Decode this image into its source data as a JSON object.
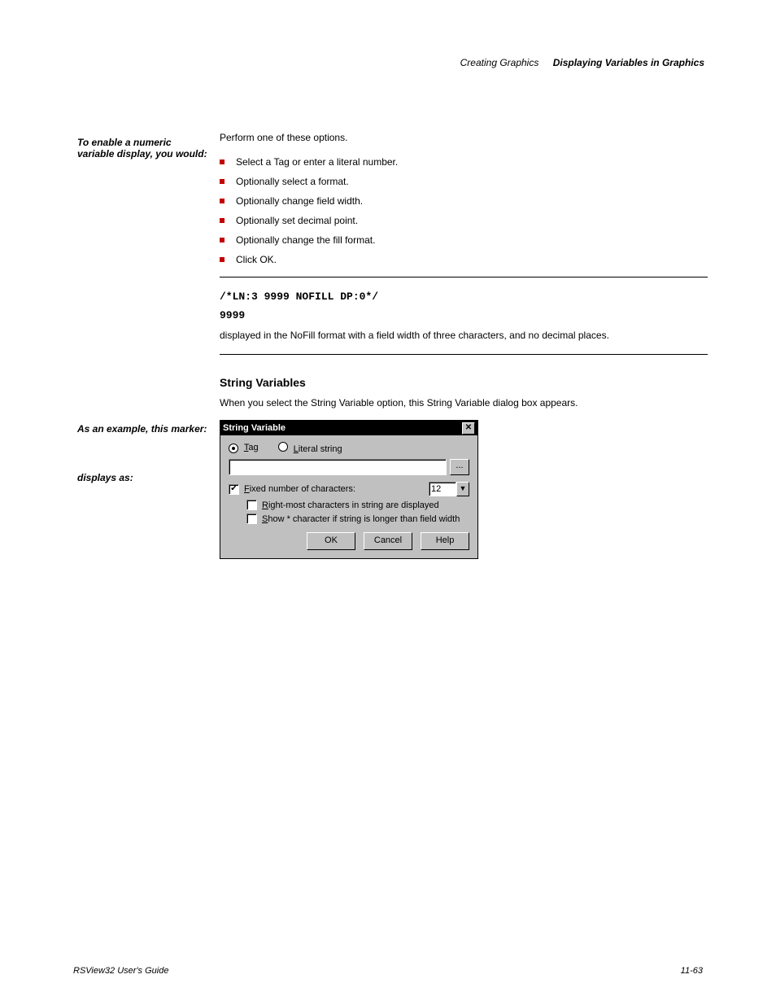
{
  "header": {
    "chapter": "Creating Graphics",
    "section": "Displaying Variables in Graphics"
  },
  "sideLabels": {
    "enable": "To enable a numeric variable display, you would:",
    "example": "As an example, this marker:",
    "result": "displays as:"
  },
  "enableSteps": {
    "intro": "Perform one of these options.",
    "items": [
      "Select a Tag or enter a literal number.",
      "Optionally select a format.",
      "Optionally change field width.",
      "Optionally set decimal point.",
      "Optionally change the fill format.",
      "Click OK."
    ]
  },
  "exampleCode": "/*LN:3 9999 NOFILL DP:0*/",
  "resultValue": "9999",
  "resultNote": "displayed in the NoFill format with a field width of three characters, and no decimal places.",
  "stringSection": {
    "heading": "String Variables",
    "sub": "When you select the String Variable option, this String Variable dialog box appears."
  },
  "dialog": {
    "title": "String Variable",
    "radios": {
      "tag": "Tag",
      "literal": "Literal string"
    },
    "browse": "...",
    "fixed": {
      "label": "Fixed number of characters:",
      "value": "12"
    },
    "rightmost": "Right-most characters in string are displayed",
    "showstar": "Show * character if string is longer than field width",
    "buttons": {
      "ok": "OK",
      "cancel": "Cancel",
      "help": "Help"
    }
  },
  "footer": {
    "product": "RSView32 User's Guide",
    "page": "11-63"
  }
}
